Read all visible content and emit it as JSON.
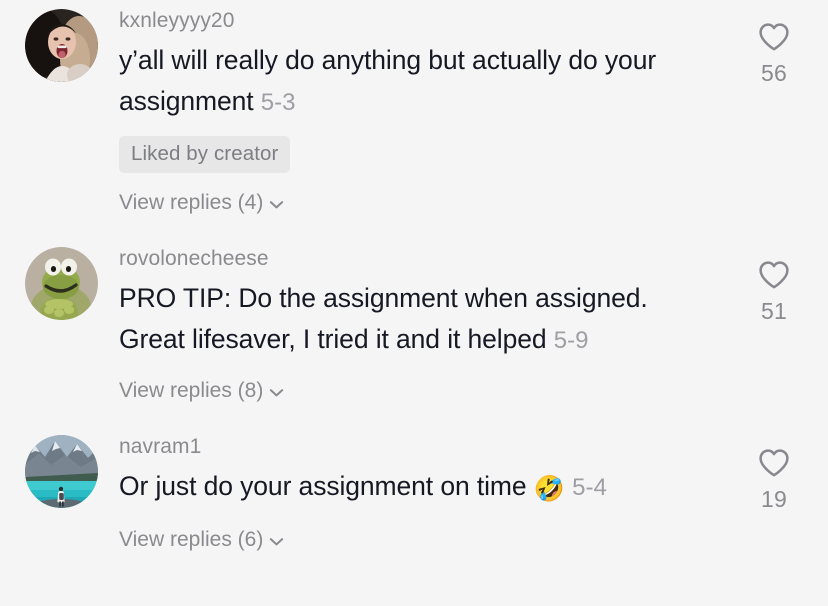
{
  "app": {
    "screen": "tiktok-comment-list",
    "background_color": "#f5f5f5",
    "text_color": "#161823",
    "muted_color": "#8a8a8f"
  },
  "comments": [
    {
      "username": "kxnleyyyy20",
      "avatar_name": "avatar-selfie-blonde",
      "text": "y’all will really do anything but actually do your assignment",
      "timestamp": "5-3",
      "liked_by_creator": true,
      "creator_badge_label": "Liked by creator",
      "replies_label": "View replies (4)",
      "reply_count": 4,
      "likes": "56"
    },
    {
      "username": "rovolonecheese",
      "avatar_name": "avatar-kermit-frog",
      "text": "PRO TIP: Do the assignment when assigned. Great lifesaver, I tried it and it helped",
      "timestamp": "5-9",
      "liked_by_creator": false,
      "creator_badge_label": "",
      "replies_label": "View replies (8)",
      "reply_count": 8,
      "likes": "51"
    },
    {
      "username": "navram1",
      "avatar_name": "avatar-mountain-lake",
      "text": "Or just do your assignment on time",
      "emoji": "🤣",
      "timestamp": "5-4",
      "liked_by_creator": false,
      "creator_badge_label": "",
      "replies_label": "View replies (6)",
      "reply_count": 6,
      "likes": "19"
    }
  ],
  "icons": {
    "heart": "heart-outline-icon",
    "chevron": "chevron-down-icon"
  }
}
